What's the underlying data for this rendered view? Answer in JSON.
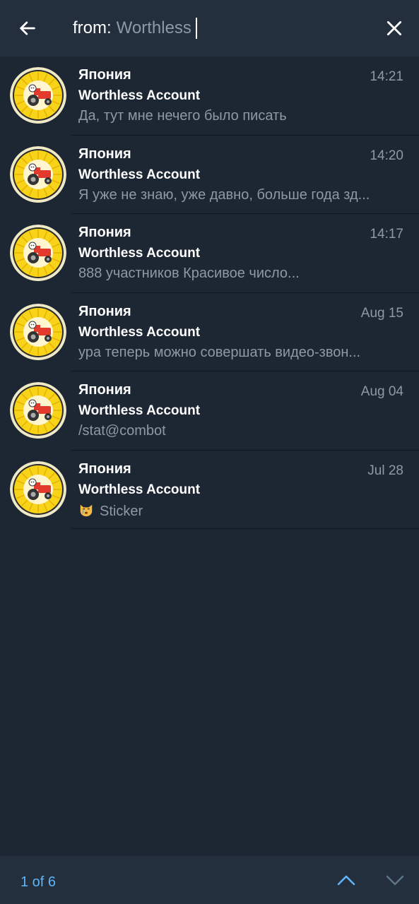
{
  "search": {
    "prefix": "from:",
    "query": "Worthless"
  },
  "icons": {
    "back": "arrow-left-icon",
    "close": "close-icon",
    "up": "chevron-up-icon",
    "down": "chevron-down-icon",
    "avatar": "lemon-tractor-avatar",
    "sticker": "crying-cat-emoji"
  },
  "colors": {
    "background": "#1d2733",
    "header": "#242f3d",
    "accent": "#5eb5f7",
    "secondary_text": "#8e99a6",
    "avatar_yellow": "#f7d31a"
  },
  "results": [
    {
      "chat": "Япония",
      "time": "14:21",
      "sender": "Worthless Account",
      "text": "Да, тут мне нечего было писать"
    },
    {
      "chat": "Япония",
      "time": "14:20",
      "sender": "Worthless Account",
      "text": "Я уже не знаю, уже давно, больше года зд..."
    },
    {
      "chat": "Япония",
      "time": "14:17",
      "sender": "Worthless Account",
      "text": "888 участников Красивое число..."
    },
    {
      "chat": "Япония",
      "time": "Aug 15",
      "sender": "Worthless Account",
      "text": "ура теперь можно совершать видео-звон..."
    },
    {
      "chat": "Япония",
      "time": "Aug 04",
      "sender": "Worthless Account",
      "text": "/stat@combot"
    },
    {
      "chat": "Япония",
      "time": "Jul 28",
      "sender": "Worthless Account",
      "text": "Sticker",
      "emoji": true
    }
  ],
  "footer": {
    "counter": "1 of 6"
  }
}
